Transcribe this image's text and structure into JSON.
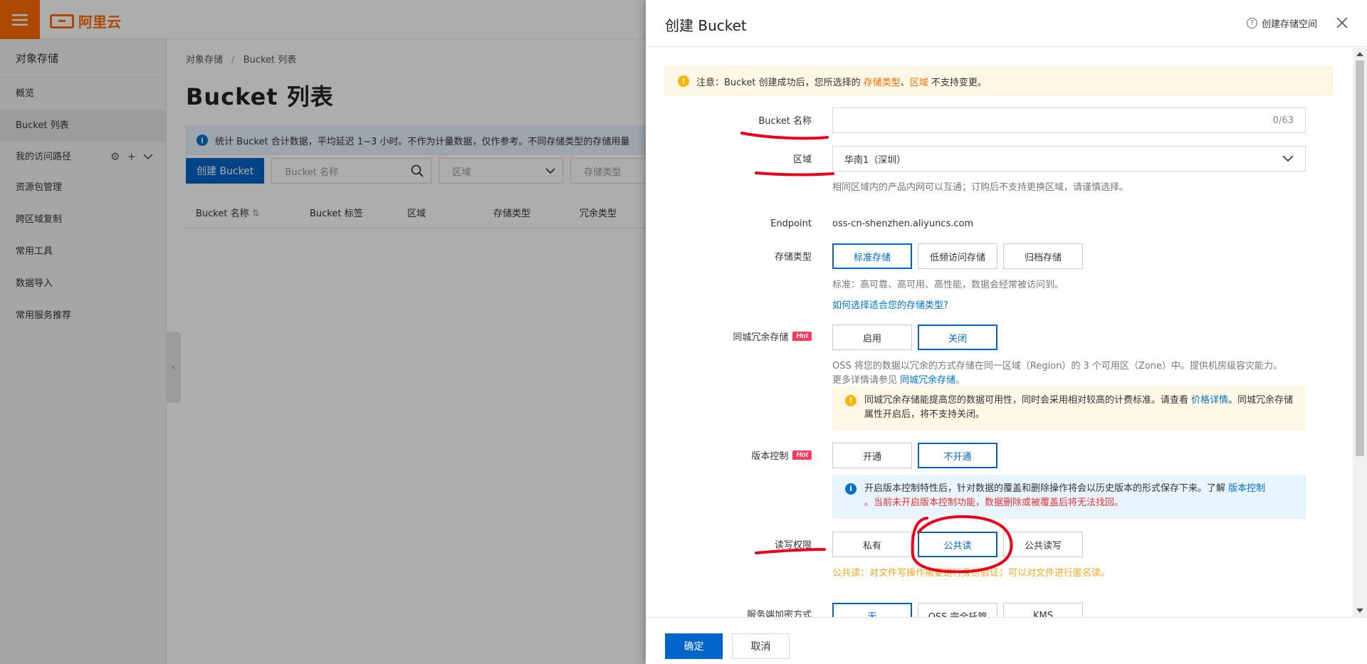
{
  "brand": {
    "logo_text": "阿里云",
    "accent": "#ff6a00",
    "primary": "#0064c8"
  },
  "sidebar": {
    "title": "对象存储",
    "items": [
      {
        "label": "概览"
      },
      {
        "label": "Bucket 列表",
        "active": true
      },
      {
        "label": "我的访问路径"
      },
      {
        "label": "资源包管理"
      },
      {
        "label": "跨区域复制"
      },
      {
        "label": "常用工具"
      },
      {
        "label": "数据导入"
      },
      {
        "label": "常用服务推荐"
      }
    ]
  },
  "main": {
    "breadcrumb": [
      "对象存储",
      "Bucket 列表"
    ],
    "breadcrumb_sep": "/",
    "title": "Bucket 列表",
    "info": "统计 Bucket 合计数据，平均延迟 1~3 小时。不作为计量数据，仅作参考。不同存储类型的存储用量",
    "create_button": "创建 Bucket",
    "search_placeholder": "Bucket 名称",
    "filter_region": "区域",
    "filter_storage": "存储类型",
    "columns": [
      "Bucket 名称",
      "Bucket 标签",
      "区域",
      "存储类型",
      "冗余类型"
    ]
  },
  "drawer": {
    "title": "创建 Bucket",
    "help_link": "创建存储空间",
    "warning_prefix": "注意：Bucket 创建成功后，您所选择的 ",
    "warning_storage": "存储类型",
    "warning_sep": "、",
    "warning_region": "区域",
    "warning_suffix": " 不支持变更。",
    "bucket_name_label": "Bucket 名称",
    "bucket_name_counter": "0/63",
    "region_label": "区域",
    "region_value": "华南1（深圳）",
    "region_hint": "相同区域内的产品内网可以互通；订购后不支持更换区域，请谨慎选择。",
    "endpoint_label": "Endpoint",
    "endpoint_value": "oss-cn-shenzhen.aliyuncs.com",
    "storage_label": "存储类型",
    "storage_options": [
      "标准存储",
      "低频访问存储",
      "归档存储"
    ],
    "storage_hint": "标准：高可靠、高可用、高性能，数据会经常被访问到。",
    "storage_link": "如何选择适合您的存储类型?",
    "zrs_label": "同城冗余存储",
    "hot_badge": "Hot",
    "zrs_options": [
      "启用",
      "关闭"
    ],
    "zrs_hint_line1": "OSS 将您的数据以冗余的方式存储在同一区域（Region）的 3 个可用区（Zone）中。提供机房级容灾能力。",
    "zrs_hint_line2_prefix": "更多详情请参见 ",
    "zrs_hint_link": "同城冗余存储",
    "zrs_hint_line2_suffix": "。",
    "zrs_notice_prefix": "同城冗余存储能提高您的数据可用性，同时会采用相对较高的计费标准。请查看 ",
    "zrs_notice_link": "价格详情",
    "zrs_notice_suffix": "。同城冗余存储属性开启后，将不支持关闭。",
    "version_label": "版本控制",
    "version_options": [
      "开通",
      "不开通"
    ],
    "version_notice_prefix": "开启版本控制特性后，针对数据的覆盖和删除操作将会以历史版本的形式保存下来。了解 ",
    "version_notice_link": "版本控制",
    "version_notice_red": "。当前未开启版本控制功能，数据删除或被覆盖后将无法找回。",
    "acl_label": "读写权限",
    "acl_options": [
      "私有",
      "公共读",
      "公共读写"
    ],
    "acl_warning": "公共读：对文件写操作需要进行身份验证；可以对文件进行匿名读。",
    "encrypt_label": "服务端加密方式",
    "encrypt_options": [
      "无",
      "OSS 完全托管",
      "KMS"
    ],
    "ok_button": "确定",
    "cancel_button": "取消"
  },
  "annotation_color": "#e8001c"
}
